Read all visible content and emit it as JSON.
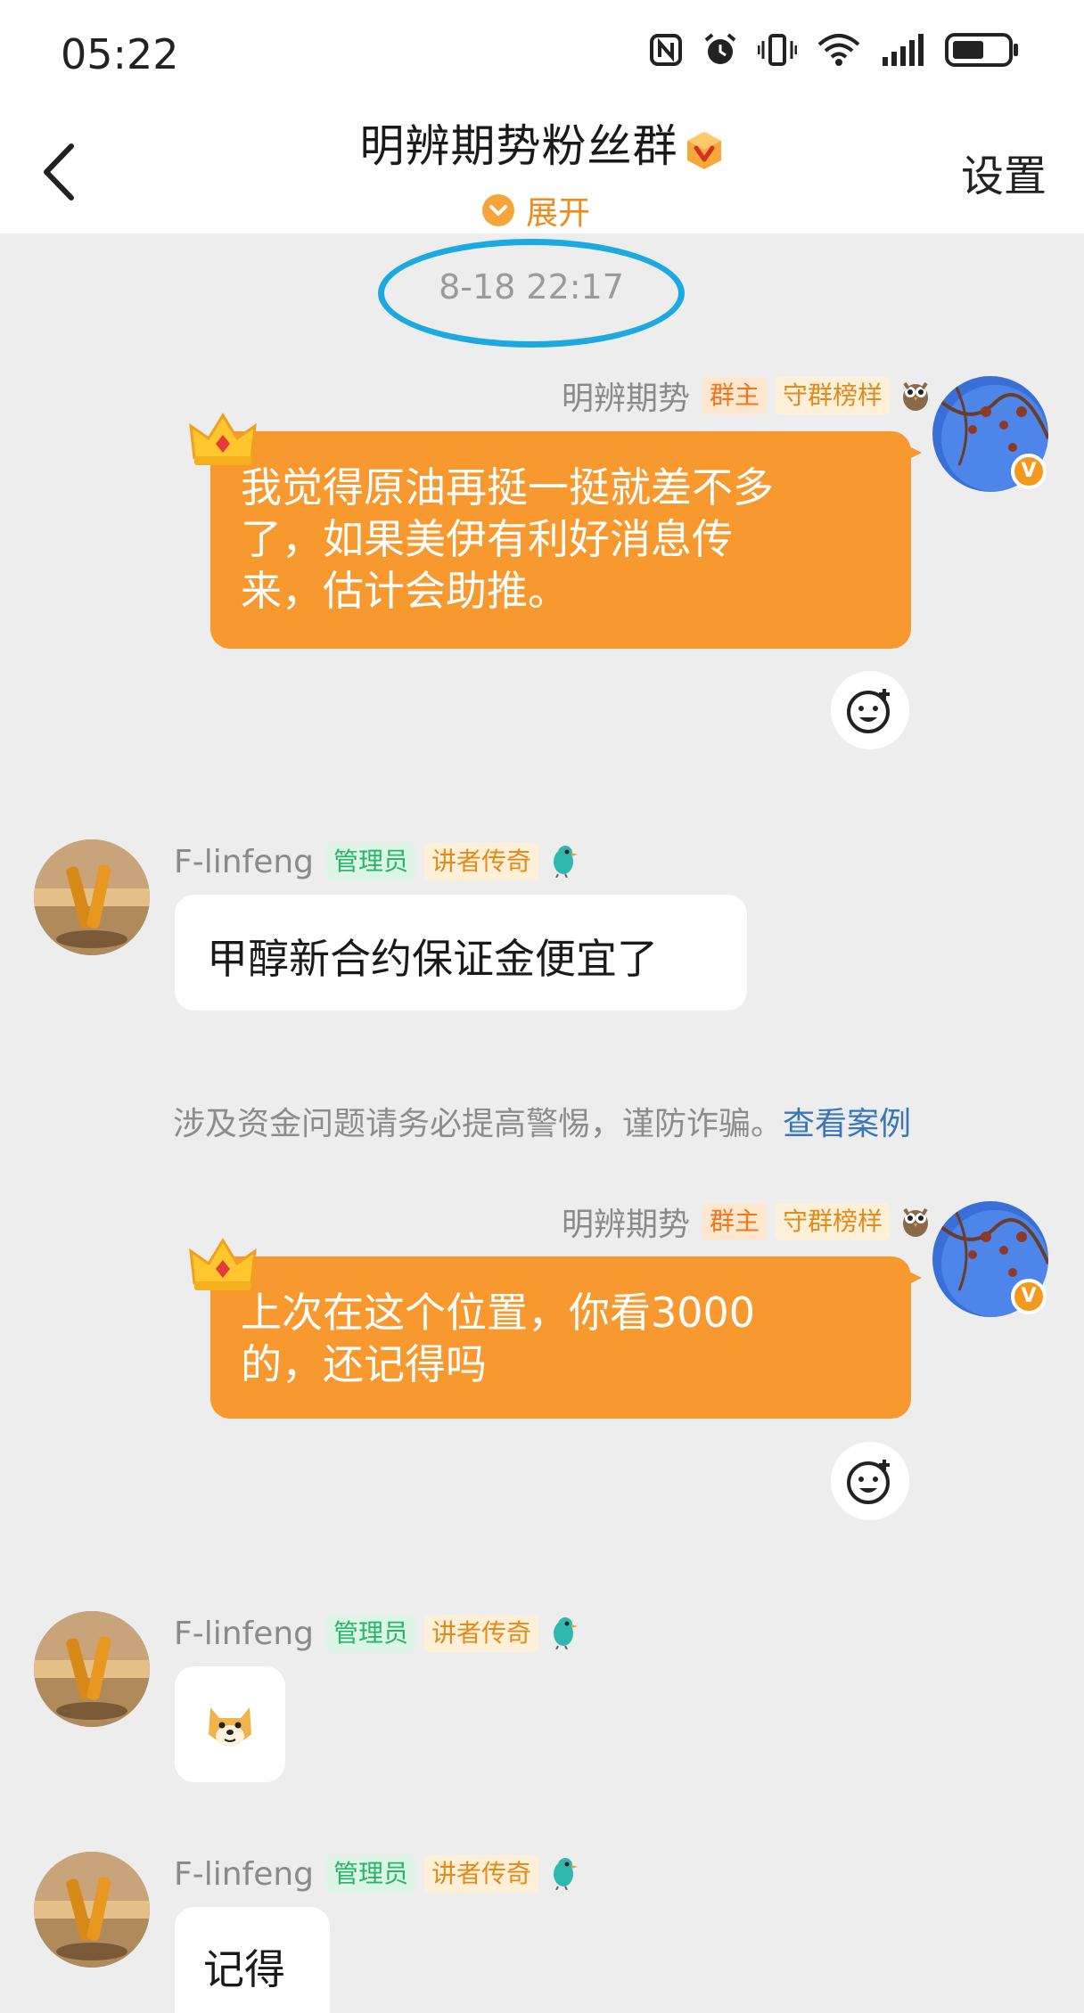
{
  "status_bar": {
    "time": "05:22",
    "icons": [
      "nfc-icon",
      "alarm-icon",
      "vibrate-icon",
      "wifi-icon",
      "signal-icon",
      "battery-icon"
    ]
  },
  "header": {
    "title": "明辨期势粉丝群",
    "expand_label": "展开",
    "settings_label": "设置"
  },
  "timestamp": "8-18 22:17",
  "messages": [
    {
      "sender": "明辨期势",
      "tags": [
        "群主",
        "守群榜样"
      ],
      "side": "right",
      "text_lines": [
        "我觉得原油再挺一挺就差不多",
        "了，如果美伊有利好消息传",
        "来，估计会助推。"
      ]
    },
    {
      "sender": "F-linfeng",
      "tags": [
        "管理员",
        "讲者传奇"
      ],
      "side": "left",
      "text": "甲醇新合约保证金便宜了"
    },
    {
      "sender": "明辨期势",
      "tags": [
        "群主",
        "守群榜样"
      ],
      "side": "right",
      "text_lines": [
        "上次在这个位置，你看3000",
        "的，还记得吗"
      ]
    },
    {
      "sender": "F-linfeng",
      "tags": [
        "管理员",
        "讲者传奇"
      ],
      "side": "left",
      "emoji": "doge-emoji"
    },
    {
      "sender": "F-linfeng",
      "tags": [
        "管理员",
        "讲者传奇"
      ],
      "side": "left",
      "text": "记得"
    }
  ],
  "notice": {
    "text": "涉及资金问题请务必提高警惕，谨防诈骗。",
    "link": "查看案例"
  },
  "colors": {
    "accent": "#f8992f",
    "link": "#3a76b8",
    "highlight_ring": "#1aa9e0"
  }
}
